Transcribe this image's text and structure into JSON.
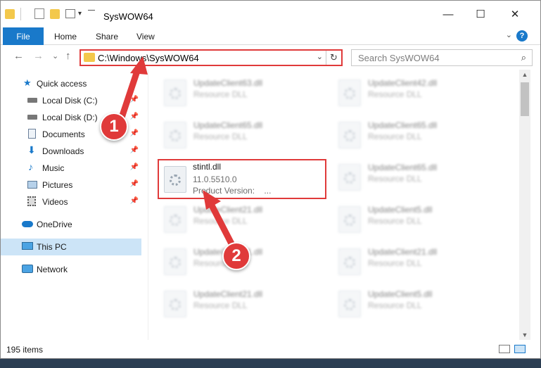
{
  "window": {
    "title": "SysWOW64",
    "minimize_glyph": "—",
    "maximize_glyph": "☐",
    "close_glyph": "✕"
  },
  "ribbon": {
    "tabs": [
      {
        "label": "File"
      },
      {
        "label": "Home"
      },
      {
        "label": "Share"
      },
      {
        "label": "View"
      }
    ],
    "help_glyph": "?"
  },
  "nav": {
    "back_glyph": "←",
    "forward_glyph": "→",
    "recent_glyph": "⌄",
    "up_glyph": "↑",
    "address": "C:\\Windows\\SysWOW64",
    "search_placeholder": "Search SysWOW64"
  },
  "sidebar": {
    "items": [
      {
        "label": "Quick access",
        "icon": "star-icon"
      },
      {
        "label": "Local Disk (C:)",
        "icon": "drive-icon",
        "pinned": true
      },
      {
        "label": "Local Disk (D:)",
        "icon": "drive-icon",
        "pinned": true
      },
      {
        "label": "Documents",
        "icon": "documents-icon",
        "pinned": true
      },
      {
        "label": "Downloads",
        "icon": "download-icon",
        "pinned": true
      },
      {
        "label": "Music",
        "icon": "music-icon",
        "pinned": true
      },
      {
        "label": "Pictures",
        "icon": "pictures-icon",
        "pinned": true
      },
      {
        "label": "Videos",
        "icon": "video-icon",
        "pinned": true
      },
      {
        "label": "OneDrive",
        "icon": "cloud-icon"
      },
      {
        "label": "This PC",
        "icon": "computer-icon",
        "selected": true
      },
      {
        "label": "Network",
        "icon": "network-icon"
      }
    ]
  },
  "files": {
    "left": [
      {
        "name": "UpdateClient63.dll",
        "type": "Resource DLL"
      },
      {
        "name": "UpdateClient65.dll",
        "type": "Resource DLL"
      },
      {
        "name": "stintl.dll",
        "version": "11.0.5510.0",
        "product": "Product Version:",
        "product_value": "..."
      },
      {
        "name": "UpdateClient21.dll",
        "type": "Resource DLL"
      },
      {
        "name": "UpdateClient21.dll",
        "type": "Resource DLL"
      },
      {
        "name": "UpdateClient21.dll",
        "type": "Resource DLL"
      }
    ],
    "right": [
      {
        "name": "UpdateClient42.dll",
        "type": "Resource DLL"
      },
      {
        "name": "UpdateClient65.dll",
        "type": "Resource DLL"
      },
      {
        "name": "UpdateClient65.dll",
        "type": "Resource DLL"
      },
      {
        "name": "UpdateClient5.dll",
        "type": "Resource DLL"
      },
      {
        "name": "UpdateClient21.dll",
        "type": "Resource DLL"
      },
      {
        "name": "UpdateClient5.dll",
        "type": "Resource DLL"
      }
    ]
  },
  "status": {
    "count": "195 items"
  },
  "annotations": {
    "step1": "1",
    "step2": "2"
  },
  "colors": {
    "accent": "#1979ca",
    "highlight": "#e03a3a",
    "selected": "#cce4f7"
  }
}
